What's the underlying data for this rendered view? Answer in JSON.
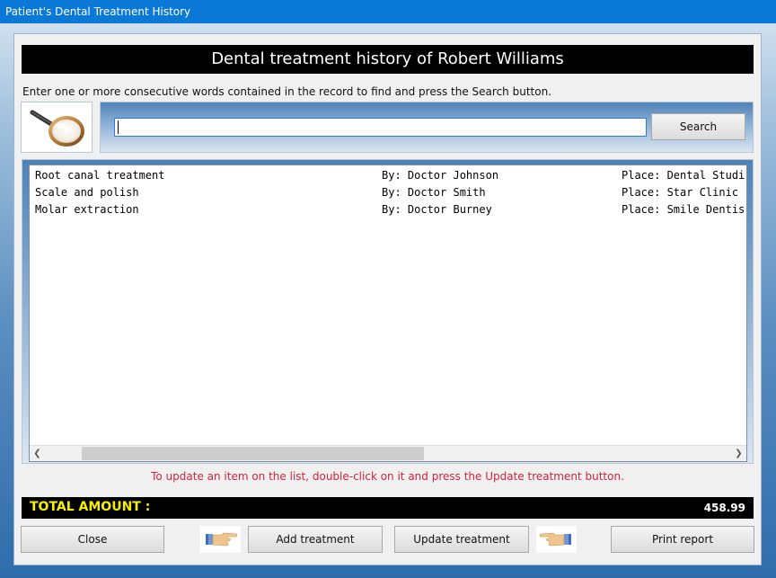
{
  "window": {
    "title": "Patient's Dental Treatment History"
  },
  "header": {
    "title": "Dental treatment history of Robert Williams"
  },
  "search": {
    "instruction": "Enter one or more consecutive words contained in the record to find and press the Search button.",
    "value": "",
    "button_label": "Search",
    "icon": "magnifier-icon"
  },
  "records": [
    {
      "treatment": "Root canal treatment",
      "by": "By: Doctor Johnson",
      "place": "Place: Dental Studi"
    },
    {
      "treatment": "Scale and polish",
      "by": "By: Doctor Smith",
      "place": "Place: Star Clinic"
    },
    {
      "treatment": "Molar extraction",
      "by": "By: Doctor Burney",
      "place": "Place: Smile Dentis"
    }
  ],
  "hint": "To update an item on the list, double-click on it and press the Update treatment button.",
  "total": {
    "label": "TOTAL AMOUNT :",
    "value": "458.99"
  },
  "buttons": {
    "close": "Close",
    "add": "Add treatment",
    "update": "Update treatment",
    "print": "Print report"
  },
  "colors": {
    "titlebar": "#0a78d7",
    "header_bg": "#000000",
    "total_label": "#f6f000",
    "hint_text": "#d0243b"
  },
  "icons": {
    "left_hand": "pointing-hand-right-icon",
    "right_hand": "pointing-hand-left-icon"
  }
}
